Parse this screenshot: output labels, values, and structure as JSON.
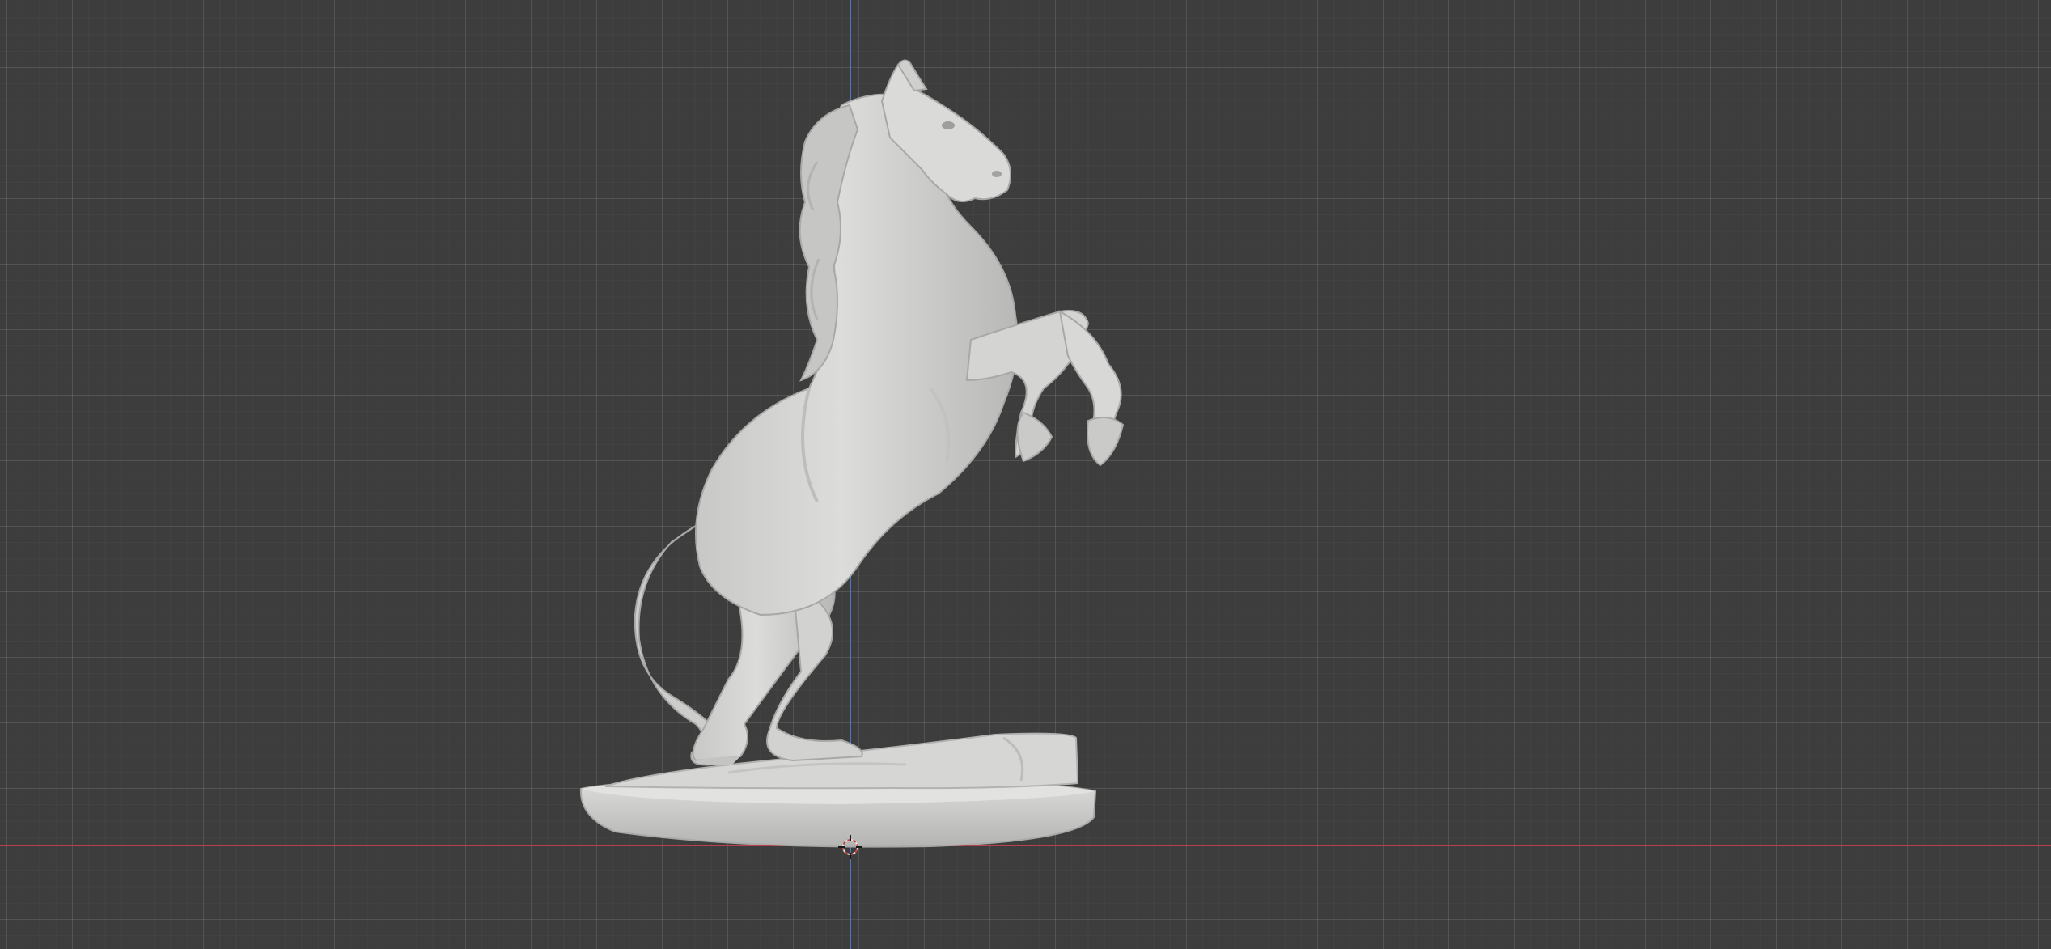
{
  "viewport": {
    "background_color": "#3d3d3d",
    "grid_visible": true,
    "x_axis_color": "#b5434d",
    "z_axis_color": "#4a76c4",
    "object": {
      "icon": "rearing-horse-statue",
      "material_color": "#d0d0ce",
      "shadow_color": "#9c9c9a"
    },
    "cursor_icon": "3d-cursor-icon"
  }
}
